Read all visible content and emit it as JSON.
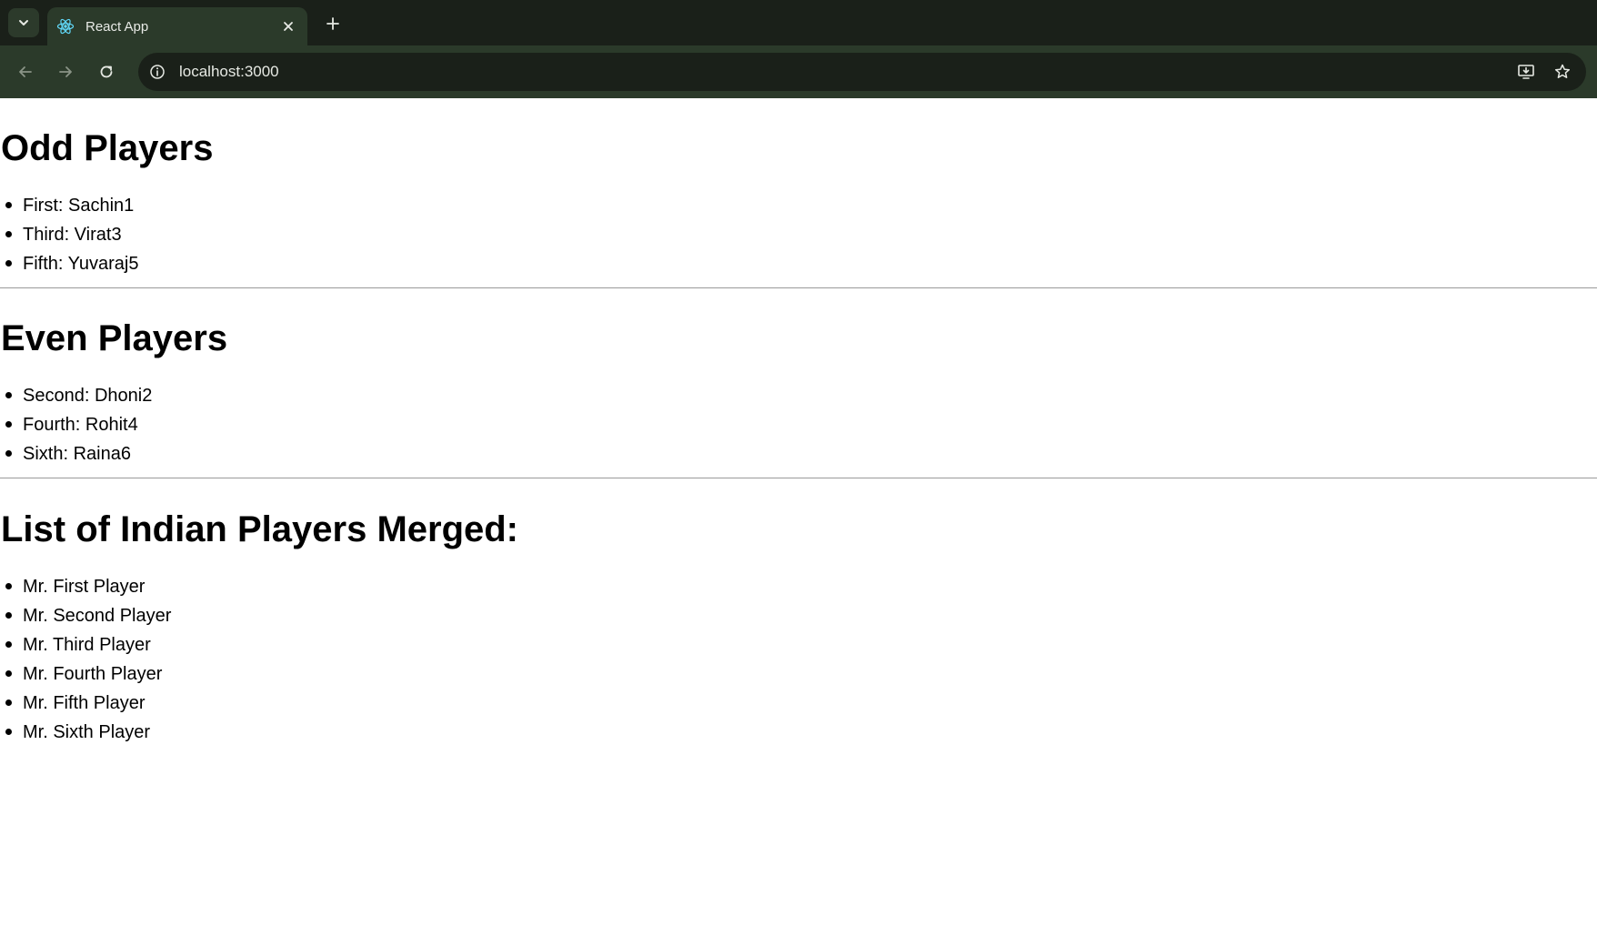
{
  "browser": {
    "tab_title": "React App",
    "url": "localhost:3000",
    "icons": {
      "tab_search": "chevron-down-icon",
      "favicon": "react-logo-icon",
      "tab_close": "close-icon",
      "new_tab": "plus-icon",
      "back": "arrow-left-icon",
      "forward": "arrow-right-icon",
      "reload": "reload-icon",
      "site_info": "info-icon",
      "install": "install-app-icon",
      "bookmark": "star-icon"
    },
    "colors": {
      "chrome_dark": "#1a2019",
      "chrome_light": "#2b3a2a",
      "chrome_text": "#e6e9e3"
    }
  },
  "page": {
    "odd": {
      "heading": "Odd Players",
      "items": [
        "First: Sachin1",
        "Third: Virat3",
        "Fifth: Yuvaraj5"
      ]
    },
    "even": {
      "heading": "Even Players",
      "items": [
        "Second: Dhoni2",
        "Fourth: Rohit4",
        "Sixth: Raina6"
      ]
    },
    "merged": {
      "heading": "List of Indian Players Merged:",
      "items": [
        "Mr. First Player",
        "Mr. Second Player",
        "Mr. Third Player",
        "Mr. Fourth Player",
        "Mr. Fifth Player",
        "Mr. Sixth Player"
      ]
    }
  }
}
